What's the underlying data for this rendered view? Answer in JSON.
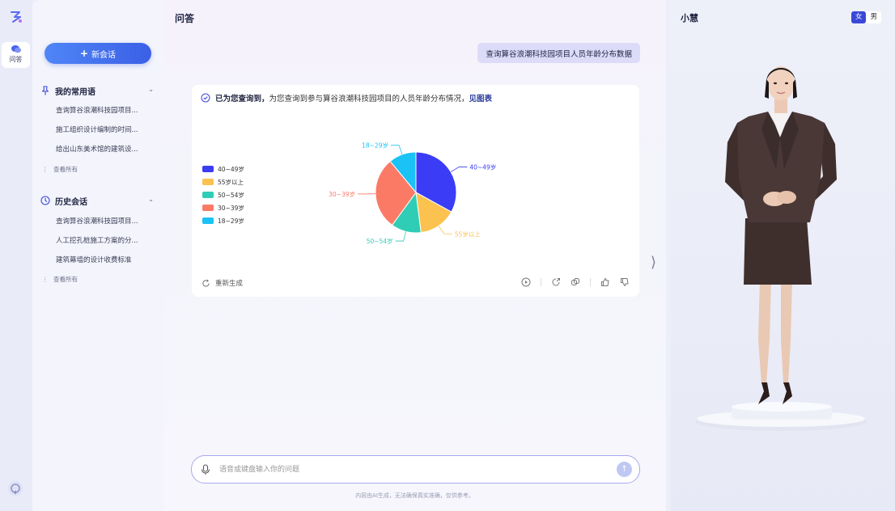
{
  "rail": {
    "nav_label": "问答"
  },
  "side": {
    "new_chat_label": "新会话",
    "favorites": {
      "title": "我的常用语",
      "items": [
        "查询算谷浪潮科技园项目...",
        "施工组织设计编制的时间...",
        "给出山东美术馆的建筑设..."
      ],
      "see_all": "查看所有"
    },
    "history": {
      "title": "历史会话",
      "items": [
        "查询算谷浪潮科技园项目...",
        "人工挖孔桩施工方案的分...",
        "建筑幕墙的设计收费标准"
      ],
      "see_all": "查看所有"
    }
  },
  "main": {
    "title": "问答",
    "user_message": "查询算谷浪潮科技园项目人员年龄分布数据",
    "answer": {
      "lead": "已为您查询到，",
      "body": "为您查询到参与算谷浪潮科技园项目的人员年龄分布情况，",
      "link": "见图表",
      "regenerate_label": "重新生成"
    },
    "input_placeholder": "语音或键盘输入你的问题",
    "disclaimer": "内容由AI生成，无法确保真实准确，仅供参考。"
  },
  "avatar": {
    "name": "小慧",
    "gender_options": [
      "女",
      "男"
    ],
    "gender_selected": "女"
  },
  "chart_data": {
    "type": "pie",
    "labels": [
      "40~49岁",
      "55岁以上",
      "50~54岁",
      "30~39岁",
      "18~29岁"
    ],
    "values": [
      33,
      15,
      12,
      29,
      11
    ],
    "colors": [
      "#3a3df5",
      "#fcc24f",
      "#2fcdb5",
      "#fb7a66",
      "#1bc2f5"
    ],
    "legend_placement": "left"
  }
}
